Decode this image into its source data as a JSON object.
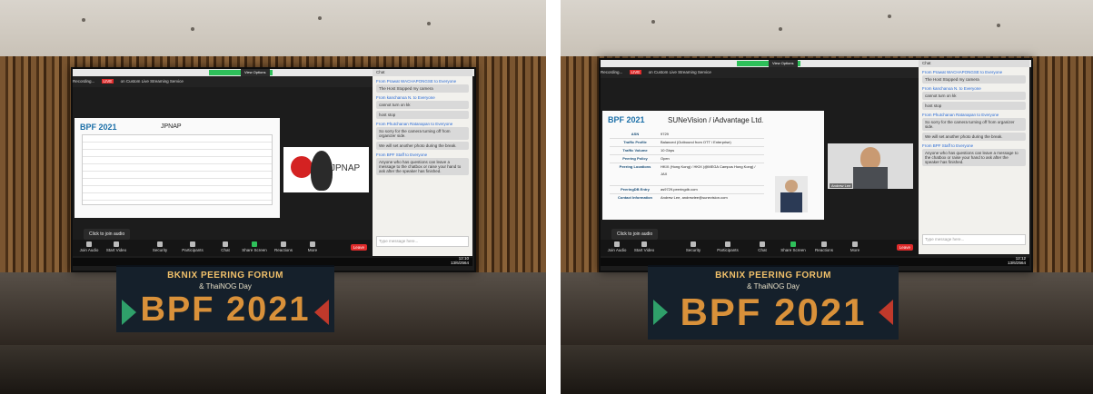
{
  "photos": [
    {
      "zoom": {
        "view_options": "View Options",
        "recording": "Recording...",
        "live": "LIVE",
        "streaming": "on Custom Live Streaming Service",
        "view": "View",
        "chat_title": "Chat"
      },
      "slide": {
        "logo": "BPF 2021",
        "title": "JPNAP",
        "brand": "JPNAP"
      },
      "chat": [
        {
          "from": "From Prawat WACHAPONGSE to Everyone",
          "text": "The Host Stopped my camera"
        },
        {
          "from": "From kanchanoa N. to Everyone",
          "text": "cannot turn on kk"
        },
        {
          "from": "",
          "text": "host stop"
        },
        {
          "from": "From Phutchanan Ratanapan to Everyone",
          "text": "So sorry for the camera turning off from organizer side."
        },
        {
          "from": "",
          "text": "We will set another photo during the break."
        },
        {
          "from": "From BPF Staff to Everyone",
          "text": "Anyone who has questions can leave a message to the chatbox or raise your hand to ask after the speaker has finished."
        }
      ],
      "chat_input": "Type message here...",
      "join_audio": "Click to join audio",
      "toolbar": [
        "Join Audio",
        "Start Video",
        "Security",
        "Participants",
        "Chat",
        "Share Screen",
        "Reactions",
        "More"
      ],
      "leave": "Leave",
      "clock": "12:10",
      "date": "13/6/2564",
      "banner": {
        "line1": "BKNIX PEERING FORUM",
        "line2": "& ThaiNOG Day",
        "line3": "BPF 2021"
      }
    },
    {
      "zoom": {
        "view_options": "View Options",
        "recording": "Recording...",
        "live": "LIVE",
        "streaming": "on Custom Live Streaming Service",
        "view": "View",
        "chat_title": "Chat"
      },
      "slide": {
        "logo": "BPF 2021",
        "title": "SUNeVision / iAdvantage Ltd.",
        "rows": [
          {
            "label": "ASN",
            "value": "9729"
          },
          {
            "label": "Traffic Profile",
            "value": "Balanced (Outbound from OTT / Enterprise)"
          },
          {
            "label": "Traffic Volume",
            "value": "10 Gbps"
          },
          {
            "label": "Peering Policy",
            "value": "Open"
          },
          {
            "label": "Peering Locations",
            "value": "HKIX (Hong Kong) / HKIX (@MEGA Campus Hong Kong) / JAX"
          },
          {
            "label": "PeeringDB Entry",
            "value": "as9729.peeringdb.com"
          },
          {
            "label": "Contact Information",
            "value": "Andrew Lee, andrewlee@sunevision.com"
          }
        ]
      },
      "chat": [
        {
          "from": "From Prawat WACHAPONGSE to Everyone",
          "text": "The Host Stopped my camera"
        },
        {
          "from": "From kanchanoa N. to Everyone",
          "text": "cannot turn on kk"
        },
        {
          "from": "",
          "text": "host stop"
        },
        {
          "from": "From Phutchanan Ratanapan to Everyone",
          "text": "So sorry for the camera turning off from organizer side."
        },
        {
          "from": "",
          "text": "We will set another photo during the break."
        },
        {
          "from": "From BPF Staff to Everyone",
          "text": "Anyone who has questions can leave a message to the chatbox or raise your hand to ask after the speaker has finished."
        }
      ],
      "chat_input": "Type message here...",
      "join_audio": "Click to join audio",
      "toolbar": [
        "Join Audio",
        "Start Video",
        "Security",
        "Participants",
        "Chat",
        "Share Screen",
        "Reactions",
        "More"
      ],
      "leave": "Leave",
      "clock": "12:12",
      "date": "13/6/2564",
      "speaker_tag": "Andrew Lee",
      "banner": {
        "line1": "BKNIX PEERING FORUM",
        "line2": "& ThaiNOG Day",
        "line3": "BPF 2021"
      }
    }
  ]
}
